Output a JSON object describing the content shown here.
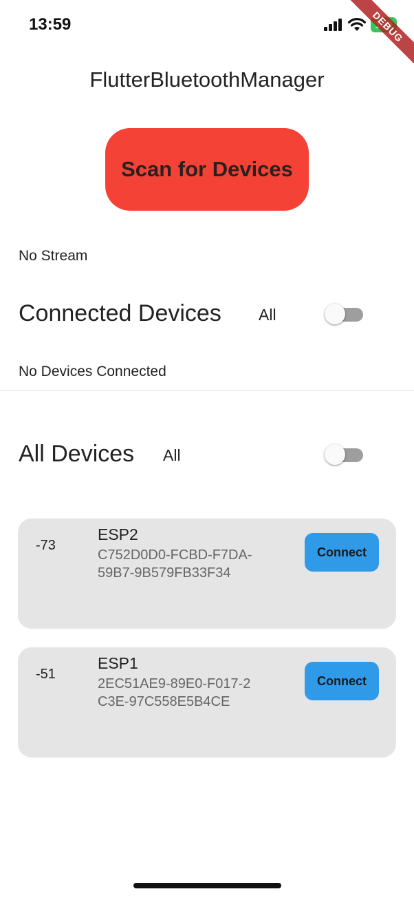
{
  "status_bar": {
    "time": "13:59",
    "signal_icon": "cellular-signal-icon",
    "wifi_icon": "wifi-icon",
    "battery_level": "100",
    "battery_color": "#35c759"
  },
  "debug_banner": "DEBUG",
  "app": {
    "title": "FlutterBluetoothManager",
    "scan_button_label": "Scan for Devices",
    "scan_button_color": "#f44336",
    "stream_status": "No Stream"
  },
  "connected_section": {
    "title": "Connected Devices",
    "filter_label": "All",
    "toggle_on": false,
    "empty_message": "No Devices Connected"
  },
  "all_section": {
    "title": "All Devices",
    "filter_label": "All",
    "toggle_on": false
  },
  "devices": [
    {
      "rssi": "-73",
      "name": "ESP2",
      "id_line1": "C752D0D0-FCBD-F7DA-",
      "id_line2": "59B7-9B579FB33F34",
      "button_label": "Connect"
    },
    {
      "rssi": "-51",
      "name": "ESP1",
      "id_line1": "2EC51AE9-89E0-F017-2",
      "id_line2": "C3E-97C558E5B4CE",
      "button_label": "Connect"
    }
  ],
  "colors": {
    "connect_button": "#2f9ae8",
    "card_background": "#e5e5e5"
  }
}
